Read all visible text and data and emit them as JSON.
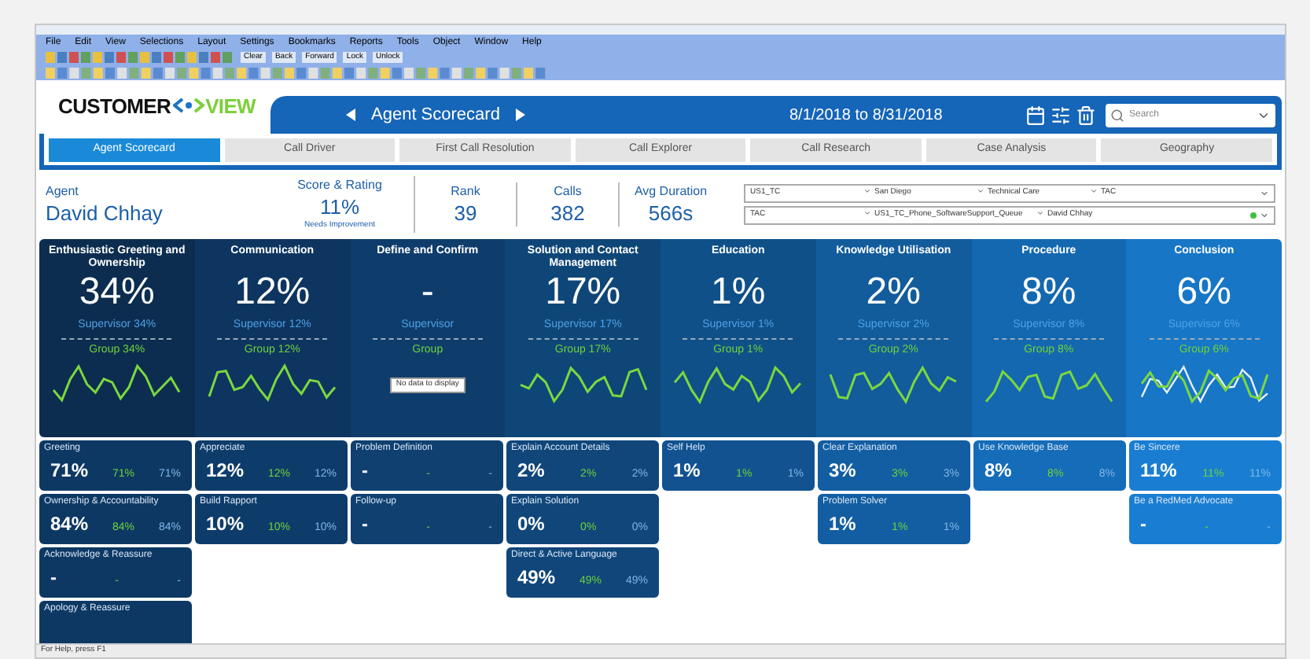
{
  "menu": [
    "File",
    "Edit",
    "View",
    "Selections",
    "Layout",
    "Settings",
    "Bookmarks",
    "Reports",
    "Tools",
    "Object",
    "Window",
    "Help"
  ],
  "toolbar_buttons": [
    "Clear",
    "Back",
    "Forward",
    "Lock",
    "Unlock"
  ],
  "logo": {
    "left": "CUSTOMER",
    "right": "VIEW"
  },
  "sheet_nav": {
    "title": "Agent Scorecard",
    "date_range": "8/1/2018 to 8/31/2018",
    "search_placeholder": "Search"
  },
  "tabs": [
    {
      "label": "Agent Scorecard",
      "selected": true
    },
    {
      "label": "Call Driver",
      "selected": false
    },
    {
      "label": "First Call Resolution",
      "selected": false
    },
    {
      "label": "Call Explorer",
      "selected": false
    },
    {
      "label": "Call Research",
      "selected": false
    },
    {
      "label": "Case Analysis",
      "selected": false
    },
    {
      "label": "Geography",
      "selected": false
    }
  ],
  "agent": {
    "label": "Agent",
    "name": "David Chhay"
  },
  "kpis": [
    {
      "label": "Score & Rating",
      "value": "11%",
      "note": "Needs Improvement"
    },
    {
      "label": "Rank",
      "value": "39"
    },
    {
      "label": "Calls",
      "value": "382"
    },
    {
      "label": "Avg Duration",
      "value": "566s"
    }
  ],
  "filters": [
    [
      "US1_TC",
      "San Diego",
      "Technical Care",
      "TAC"
    ],
    [
      "TAC",
      "US1_TC_Phone_SoftwareSupport_Queue",
      "David Chhay"
    ]
  ],
  "categories": [
    {
      "title": "Enthusiastic Greeting and Ownership",
      "value": "34%",
      "supervisor": "Supervisor 34%",
      "group": "Group 34%",
      "items": [
        {
          "name": "Greeting",
          "value": "71%",
          "group": "71%",
          "supervisor": "71%"
        },
        {
          "name": "Ownership & Accountability",
          "value": "84%",
          "group": "84%",
          "supervisor": "84%"
        },
        {
          "name": "Acknowledge & Reassure",
          "value": "-",
          "group": "-",
          "supervisor": "-"
        },
        {
          "name": "Apology & Reassure"
        }
      ]
    },
    {
      "title": "Communication",
      "value": "12%",
      "supervisor": "Supervisor 12%",
      "group": "Group 12%",
      "items": [
        {
          "name": "Appreciate",
          "value": "12%",
          "group": "12%",
          "supervisor": "12%"
        },
        {
          "name": "Build Rapport",
          "value": "10%",
          "group": "10%",
          "supervisor": "10%"
        }
      ]
    },
    {
      "title": "Define and Confirm",
      "value": "-",
      "supervisor": "Supervisor",
      "group": "Group",
      "no_data": "No data to display",
      "items": [
        {
          "name": "Problem Definition",
          "value": "-",
          "group": "-",
          "supervisor": "-"
        },
        {
          "name": "Follow-up",
          "value": "-",
          "group": "-",
          "supervisor": "-"
        }
      ]
    },
    {
      "title": "Solution and Contact Management",
      "value": "17%",
      "supervisor": "Supervisor 17%",
      "group": "Group 17%",
      "items": [
        {
          "name": "Explain Account Details",
          "value": "2%",
          "group": "2%",
          "supervisor": "2%"
        },
        {
          "name": "Explain Solution",
          "value": "0%",
          "group": "0%",
          "supervisor": "0%"
        },
        {
          "name": "Direct & Active Language",
          "value": "49%",
          "group": "49%",
          "supervisor": "49%"
        }
      ]
    },
    {
      "title": "Education",
      "value": "1%",
      "supervisor": "Supervisor 1%",
      "group": "Group 1%",
      "items": [
        {
          "name": "Self Help",
          "value": "1%",
          "group": "1%",
          "supervisor": "1%"
        }
      ]
    },
    {
      "title": "Knowledge Utilisation",
      "value": "2%",
      "supervisor": "Supervisor 2%",
      "group": "Group 2%",
      "items": [
        {
          "name": "Clear Explanation",
          "value": "3%",
          "group": "3%",
          "supervisor": "3%"
        },
        {
          "name": "Problem Solver",
          "value": "1%",
          "group": "1%",
          "supervisor": "1%"
        }
      ]
    },
    {
      "title": "Procedure",
      "value": "8%",
      "supervisor": "Supervisor 8%",
      "group": "Group 8%",
      "items": [
        {
          "name": "Use Knowledge Base",
          "value": "8%",
          "group": "8%",
          "supervisor": "8%"
        }
      ]
    },
    {
      "title": "Conclusion",
      "value": "6%",
      "supervisor": "Supervisor 6%",
      "group": "Group 6%",
      "items": [
        {
          "name": "Be Sincere",
          "value": "11%",
          "group": "11%",
          "supervisor": "11%"
        },
        {
          "name": "Be a RedMed Advocate",
          "value": "-",
          "group": "-",
          "supervisor": "-"
        }
      ]
    }
  ],
  "status_bar": "For Help, press F1"
}
